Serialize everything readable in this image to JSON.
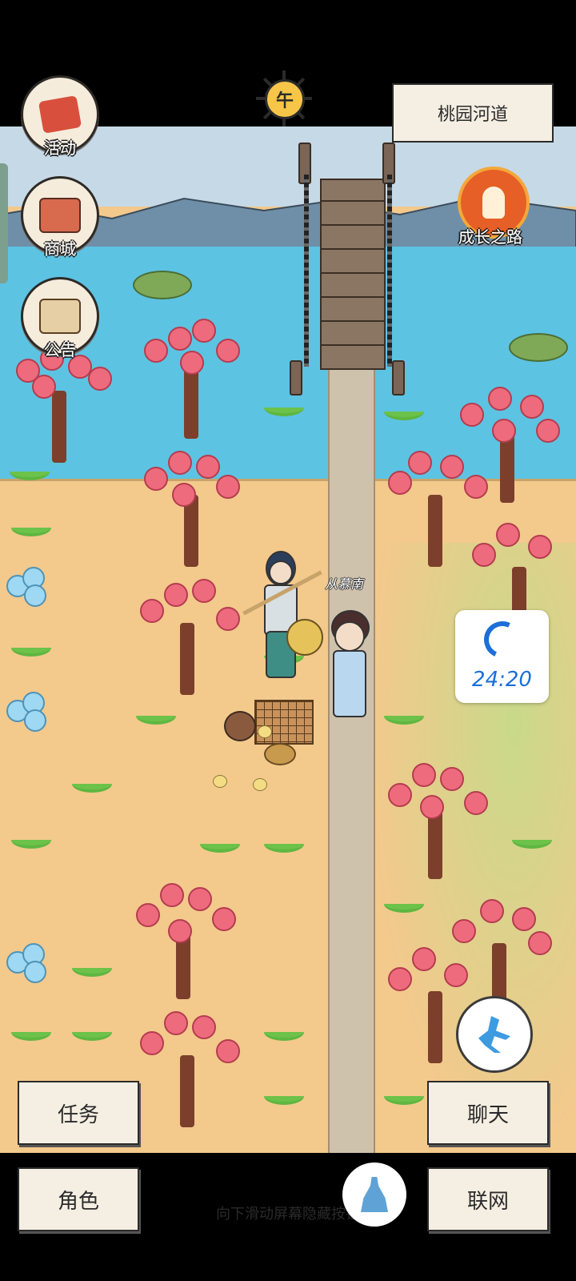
{
  "hud": {
    "time_badge": "午",
    "location": "桃园河道",
    "call_time": "24:20"
  },
  "left_menu": [
    {
      "label": "活动",
      "icon": "banner-icon"
    },
    {
      "label": "商城",
      "icon": "shop-icon"
    },
    {
      "label": "公告",
      "icon": "notice-icon"
    }
  ],
  "growth_path": {
    "label": "成长之路",
    "icon": "growth-path-icon"
  },
  "npc": {
    "name": "从慕南"
  },
  "bottom_menu": {
    "task": "任务",
    "role": "角色",
    "chat": "聊天",
    "online": "联网"
  },
  "hint": "向下滑动屏幕隐藏按钮",
  "colors": {
    "river": "#5cc3e3",
    "sand": "#f3c98c",
    "blossom": "#ee6b7d",
    "call_blue": "#1c6fd8"
  }
}
